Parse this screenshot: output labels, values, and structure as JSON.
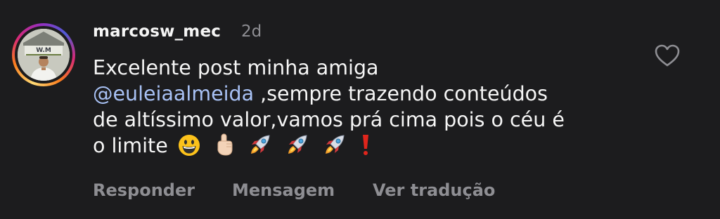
{
  "comment": {
    "username": "marcosw_mec",
    "timestamp": "2d",
    "avatar": {
      "brand_text": "W.M"
    },
    "text_line1": "Excelente post minha amiga",
    "mention": "@euleiaalmeida",
    "text_after_mention": " ,sempre trazendo conteúdos",
    "text_line3": "de altíssimo valor,vamos prá cima pois o céu é",
    "text_line4": "o limite",
    "emojis": [
      "grinning-face-icon",
      "pointing-up-icon",
      "rocket-icon",
      "rocket-icon",
      "rocket-icon",
      "red-exclamation-icon"
    ]
  },
  "actions": {
    "reply_label": "Responder",
    "message_label": "Mensagem",
    "translate_label": "Ver tradução"
  },
  "colors": {
    "background": "#1c1c1e",
    "text": "#f5f5f5",
    "secondary": "#8e8e93",
    "mention": "#a8c1f4"
  }
}
